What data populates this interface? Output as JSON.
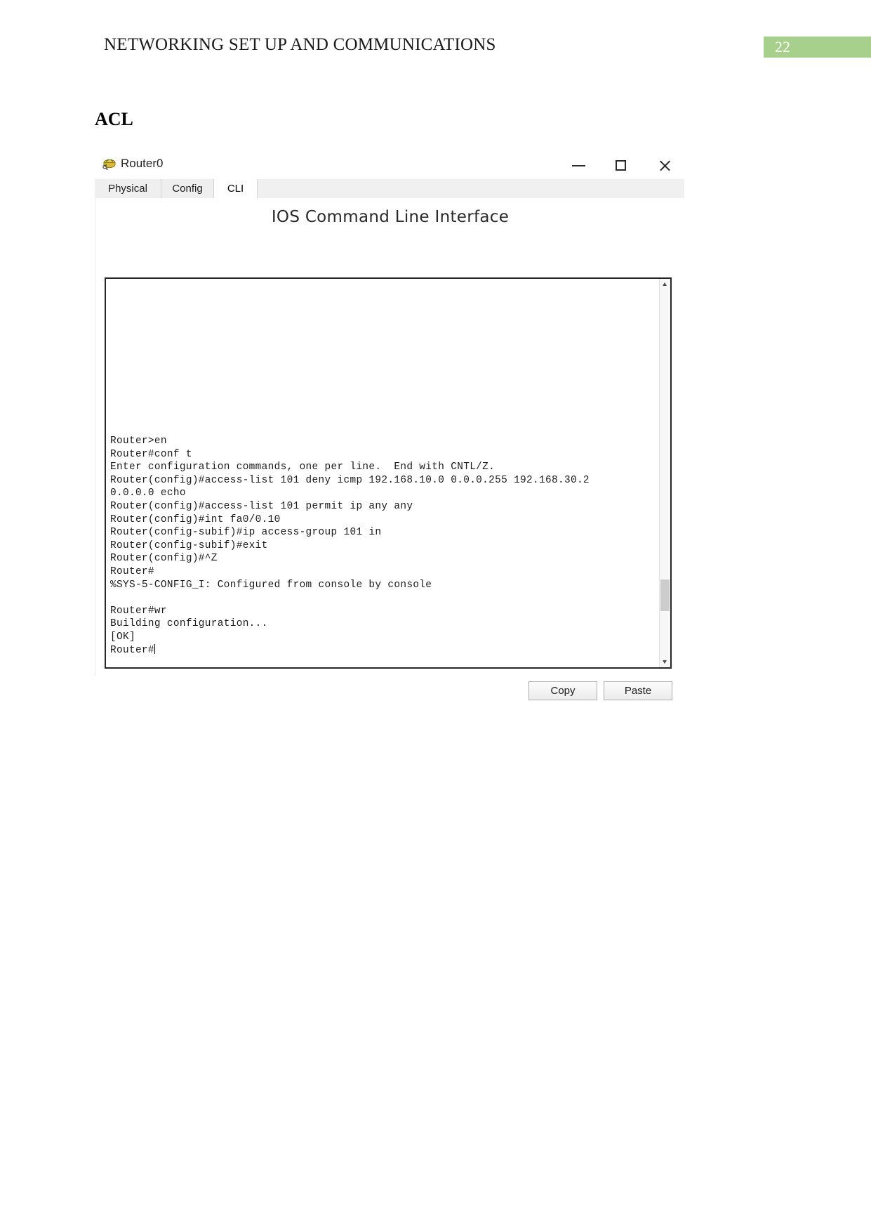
{
  "document": {
    "header_title": "NETWORKING SET UP AND COMMUNICATIONS",
    "page_number": "22",
    "accent_color": "#a8d08d",
    "section_heading": "ACL"
  },
  "window": {
    "title": "Router0",
    "icon": "router-icon",
    "controls": {
      "minimize": "minimize-icon",
      "maximize": "maximize-icon",
      "close": "close-icon"
    },
    "tabs": [
      {
        "label": "Physical",
        "active": false
      },
      {
        "label": "Config",
        "active": false
      },
      {
        "label": "CLI",
        "active": true
      }
    ],
    "cli_heading": "IOS Command Line Interface",
    "terminal": {
      "lines": [
        "Router>en",
        "Router#conf t",
        "Enter configuration commands, one per line.  End with CNTL/Z.",
        "Router(config)#access-list 101 deny icmp 192.168.10.0 0.0.0.255 192.168.30.2",
        "0.0.0.0 echo",
        "Router(config)#access-list 101 permit ip any any",
        "Router(config)#int fa0/0.10",
        "Router(config-subif)#ip access-group 101 in",
        "Router(config-subif)#exit",
        "Router(config)#^Z",
        "Router#",
        "%SYS-5-CONFIG_I: Configured from console by console",
        "",
        "Router#wr",
        "Building configuration...",
        "[OK]",
        "Router#"
      ],
      "scrollbar": {
        "up_arrow": "scroll-up-icon",
        "down_arrow": "scroll-down-icon"
      }
    },
    "buttons": {
      "copy": "Copy",
      "paste": "Paste"
    }
  }
}
